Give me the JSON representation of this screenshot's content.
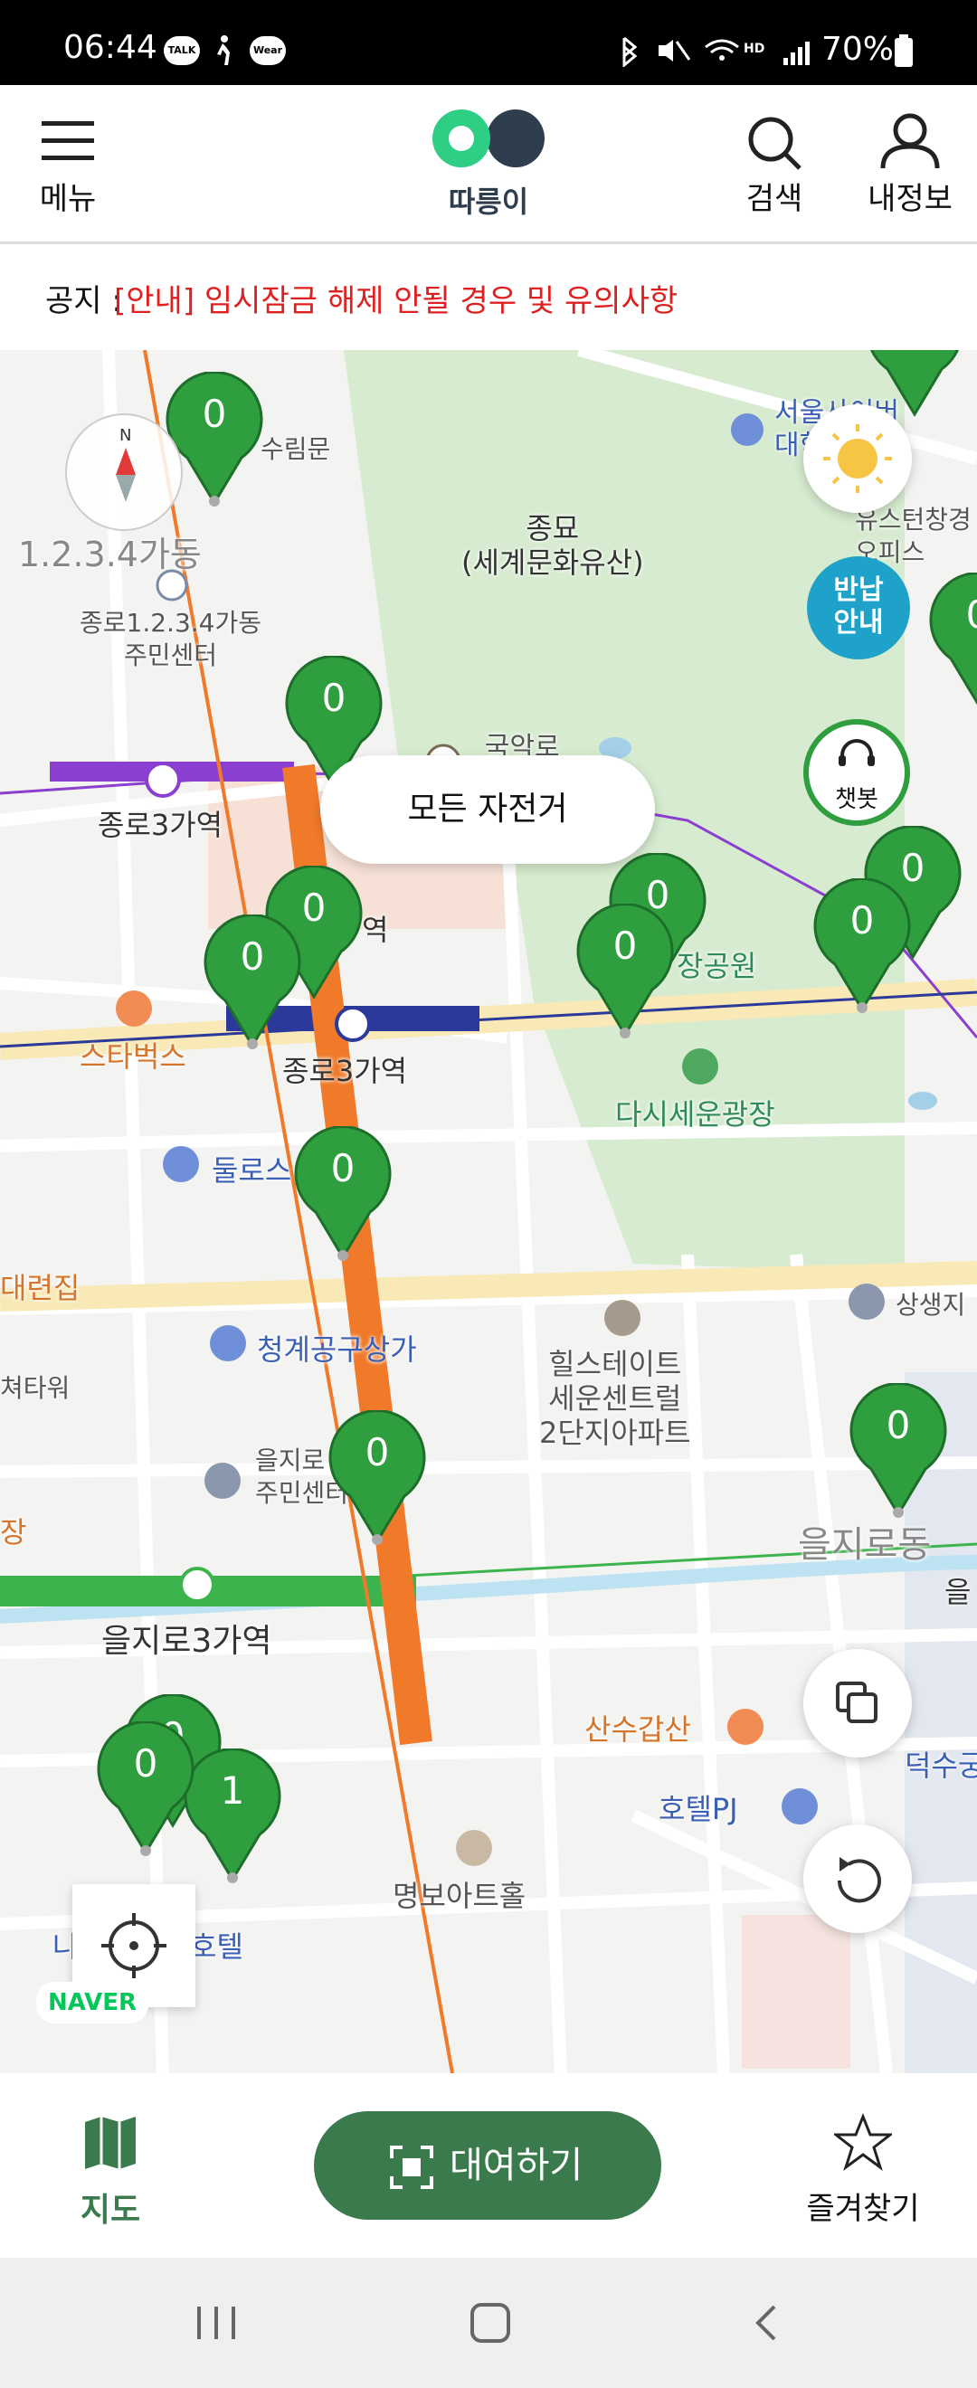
{
  "status_bar": {
    "time": "06:44",
    "icons": [
      "talk-icon",
      "walk-icon",
      "wear-icon"
    ],
    "talk_text": "TALK",
    "wear_text": "Wear",
    "battery": "70%"
  },
  "header": {
    "menu_label": "메뉴",
    "logo_label": "따릉이",
    "search_label": "검색",
    "myinfo_label": "내정보"
  },
  "notice": {
    "prefix": "공지 : ",
    "message": "[안내] 임시잠금 해제 안될 경우 및 유의사항"
  },
  "map": {
    "filter_pill": "모든 자전거",
    "return_guide": "반납\n안내",
    "chatbot": "챗봇",
    "naver": "NAVER",
    "places": {
      "sumyeong": "수림문",
      "dong": "1.2.3.4가동",
      "center": "종로1.2.3.4가동\n주민센터",
      "jongmyo": "종묘\n(세계문화유산)",
      "seoul_univ": "서울사이버\n대학교 분",
      "youth": "유스턴창경\n오피스",
      "theater": "국악로\n천우극장",
      "jongno3_5": "종로3가역",
      "station_partial": "역",
      "park": "장공원",
      "starbucks": "스타벅스",
      "jongno3_1": "종로3가역",
      "plaza": "다시세운광장",
      "dullo": "둘로스",
      "house": "대련집",
      "cheonggye": "청계공구상가",
      "tower": "쳐타워",
      "apartment": "힐스테이트\n세운센트럴\n2단지아파트",
      "sangsaeng": "상생지",
      "euljiro_center": "을지로\n주민센터",
      "euljiro_dong": "을지로동",
      "jang": "장",
      "euljiro3": "을지로3가역",
      "eul": "을",
      "sansugap": "산수갑산",
      "duksu": "덕수궁",
      "hotel_pj": "호텔PJ",
      "myeongbo": "명보아트홀",
      "hotel": "호텔",
      "n": "나"
    },
    "markers": [
      "0",
      "0",
      "0",
      "0",
      "0",
      "0",
      "0",
      "0",
      "0",
      "0",
      "0",
      "0",
      "0",
      "0",
      "1",
      "0"
    ],
    "line_numbers": {
      "line5": "5",
      "line1": "1",
      "line2": "2"
    }
  },
  "bottom_nav": {
    "map_label": "지도",
    "rent_label": "대여하기",
    "favorite_label": "즐겨찾기"
  },
  "colors": {
    "accent": "#3a7a4c",
    "marker": "#2e9e3e",
    "notice": "#e02020",
    "line1": "#2b3a9a",
    "line2": "#3cb44b",
    "line3": "#f07a2a",
    "line5": "#8a3fd1"
  }
}
